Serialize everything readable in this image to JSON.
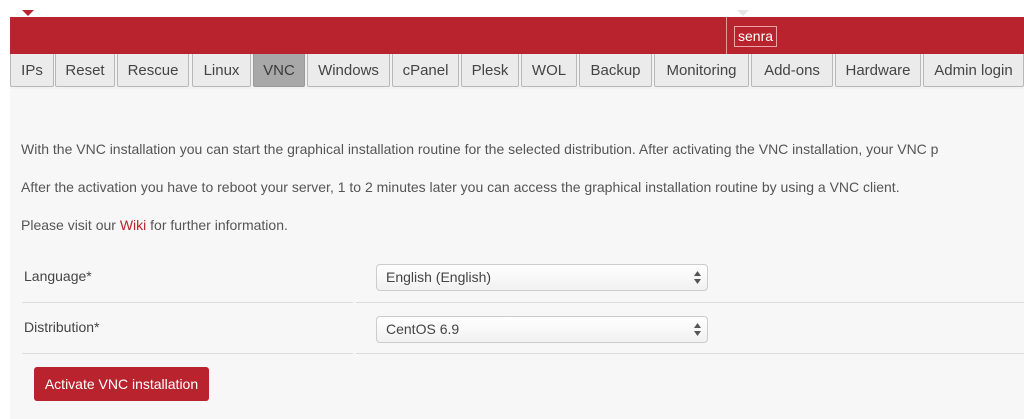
{
  "header": {
    "username": "senra",
    "accent_color": "#b8232e"
  },
  "tabs": [
    {
      "label": "IPs",
      "active": false
    },
    {
      "label": "Reset",
      "active": false
    },
    {
      "label": "Rescue",
      "active": false
    },
    {
      "label": "Linux",
      "active": false
    },
    {
      "label": "VNC",
      "active": true
    },
    {
      "label": "Windows",
      "active": false
    },
    {
      "label": "cPanel",
      "active": false
    },
    {
      "label": "Plesk",
      "active": false
    },
    {
      "label": "WOL",
      "active": false
    },
    {
      "label": "Backup",
      "active": false
    },
    {
      "label": "Monitoring",
      "active": false
    },
    {
      "label": "Add-ons",
      "active": false
    },
    {
      "label": "Hardware",
      "active": false
    },
    {
      "label": "Admin login",
      "active": false
    }
  ],
  "content": {
    "paragraph1": "With the VNC installation you can start the graphical installation routine for the selected distribution. After activating the VNC installation, your VNC p",
    "paragraph2": "After the activation you have to reboot your server, 1 to 2 minutes later you can access the graphical installation routine by using a VNC client.",
    "paragraph3_before": "Please visit our ",
    "paragraph3_link": "Wiki",
    "paragraph3_after": " for further information."
  },
  "form": {
    "language": {
      "label": "Language*",
      "value": "English (English)"
    },
    "distribution": {
      "label": "Distribution*",
      "value": "CentOS 6.9"
    },
    "submit_label": "Activate VNC installation"
  }
}
